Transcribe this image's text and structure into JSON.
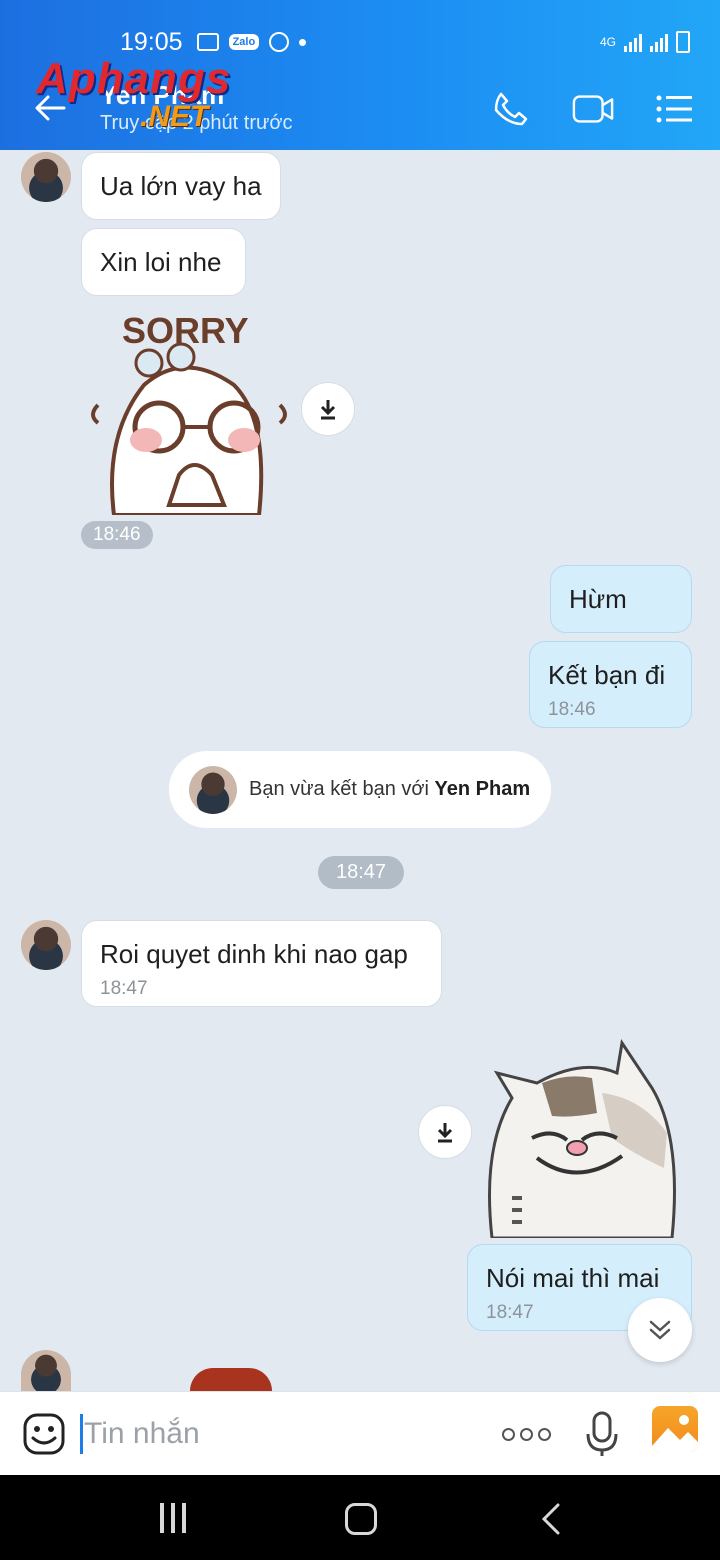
{
  "status_bar": {
    "time": "19:05",
    "network": "4G"
  },
  "header": {
    "contact_name": "Yen Pham",
    "status": "Truy cập 2 phút trước",
    "watermark_main": "Aphangs",
    "watermark_sub": ".NET"
  },
  "messages": [
    {
      "text": "Ua lớn vay ha"
    },
    {
      "text": "Xin loi nhe"
    },
    {
      "sticker_text": "SORRY"
    },
    {
      "time": "18:46"
    },
    {
      "text": "Hừm"
    },
    {
      "text": "Kết bạn đi",
      "time": "18:46"
    },
    {
      "notice_prefix": "Bạn vừa kết bạn với",
      "notice_name": "Yen Pham"
    },
    {
      "time": "18:47"
    },
    {
      "text": "Roi quyet dinh khi nao gap",
      "time": "18:47"
    },
    {
      "text": "Nói mai thì mai",
      "time": "18:47"
    }
  ],
  "input": {
    "placeholder": "Tin nhắn"
  },
  "colors": {
    "header_start": "#1d6fe0",
    "header_end": "#22a6f7",
    "my_bubble": "#d5eefc",
    "chat_bg": "#e2e9f1"
  }
}
